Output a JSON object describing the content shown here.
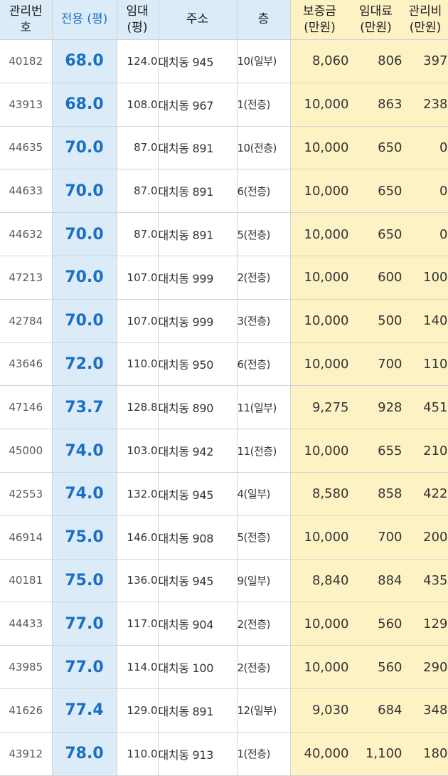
{
  "header": {
    "id_l1": "관리번",
    "id_l2": "호",
    "area": "전용 (평)",
    "rent_area_l1": "임대",
    "rent_area_l2": "(평)",
    "address": "주소",
    "floor": "층",
    "deposit_l1": "보증금",
    "deposit_l2": "(만원)",
    "rent_l1": "임대료",
    "rent_l2": "(만원)",
    "mgmt_l1": "관리비",
    "mgmt_l2": "(만원)"
  },
  "rows": [
    {
      "id": "40182",
      "area": "68.0",
      "rent_area": "124.0",
      "address": "대치동 945",
      "floor": "10(일부)",
      "deposit": "8,060",
      "rent": "806",
      "mgmt": "397"
    },
    {
      "id": "43913",
      "area": "68.0",
      "rent_area": "108.0",
      "address": "대치동 967",
      "floor": "1(전층)",
      "deposit": "10,000",
      "rent": "863",
      "mgmt": "238"
    },
    {
      "id": "44635",
      "area": "70.0",
      "rent_area": "87.0",
      "address": "대치동 891",
      "floor": "10(전층)",
      "deposit": "10,000",
      "rent": "650",
      "mgmt": "0"
    },
    {
      "id": "44633",
      "area": "70.0",
      "rent_area": "87.0",
      "address": "대치동 891",
      "floor": "6(전층)",
      "deposit": "10,000",
      "rent": "650",
      "mgmt": "0"
    },
    {
      "id": "44632",
      "area": "70.0",
      "rent_area": "87.0",
      "address": "대치동 891",
      "floor": "5(전층)",
      "deposit": "10,000",
      "rent": "650",
      "mgmt": "0"
    },
    {
      "id": "47213",
      "area": "70.0",
      "rent_area": "107.0",
      "address": "대치동 999",
      "floor": "2(전층)",
      "deposit": "10,000",
      "rent": "600",
      "mgmt": "100"
    },
    {
      "id": "42784",
      "area": "70.0",
      "rent_area": "107.0",
      "address": "대치동 999",
      "floor": "3(전층)",
      "deposit": "10,000",
      "rent": "500",
      "mgmt": "140"
    },
    {
      "id": "43646",
      "area": "72.0",
      "rent_area": "110.0",
      "address": "대치동 950",
      "floor": "6(전층)",
      "deposit": "10,000",
      "rent": "700",
      "mgmt": "110"
    },
    {
      "id": "47146",
      "area": "73.7",
      "rent_area": "128.8",
      "address": "대치동 890",
      "floor": "11(일부)",
      "deposit": "9,275",
      "rent": "928",
      "mgmt": "451"
    },
    {
      "id": "45000",
      "area": "74.0",
      "rent_area": "103.0",
      "address": "대치동 942",
      "floor": "11(전층)",
      "deposit": "10,000",
      "rent": "655",
      "mgmt": "210"
    },
    {
      "id": "42553",
      "area": "74.0",
      "rent_area": "132.0",
      "address": "대치동 945",
      "floor": "4(일부)",
      "deposit": "8,580",
      "rent": "858",
      "mgmt": "422"
    },
    {
      "id": "46914",
      "area": "75.0",
      "rent_area": "146.0",
      "address": "대치동 908",
      "floor": "5(전층)",
      "deposit": "10,000",
      "rent": "700",
      "mgmt": "200"
    },
    {
      "id": "40181",
      "area": "75.0",
      "rent_area": "136.0",
      "address": "대치동 945",
      "floor": "9(일부)",
      "deposit": "8,840",
      "rent": "884",
      "mgmt": "435"
    },
    {
      "id": "44433",
      "area": "77.0",
      "rent_area": "117.0",
      "address": "대치동 904",
      "floor": "2(전층)",
      "deposit": "10,000",
      "rent": "560",
      "mgmt": "129"
    },
    {
      "id": "43985",
      "area": "77.0",
      "rent_area": "114.0",
      "address": "대치동 100",
      "floor": "2(전층)",
      "deposit": "10,000",
      "rent": "560",
      "mgmt": "290"
    },
    {
      "id": "41626",
      "area": "77.4",
      "rent_area": "129.0",
      "address": "대치동 891",
      "floor": "12(일부)",
      "deposit": "9,030",
      "rent": "684",
      "mgmt": "348"
    },
    {
      "id": "43912",
      "area": "78.0",
      "rent_area": "110.0",
      "address": "대치동 913",
      "floor": "1(전층)",
      "deposit": "40,000",
      "rent": "1,100",
      "mgmt": "180"
    }
  ]
}
